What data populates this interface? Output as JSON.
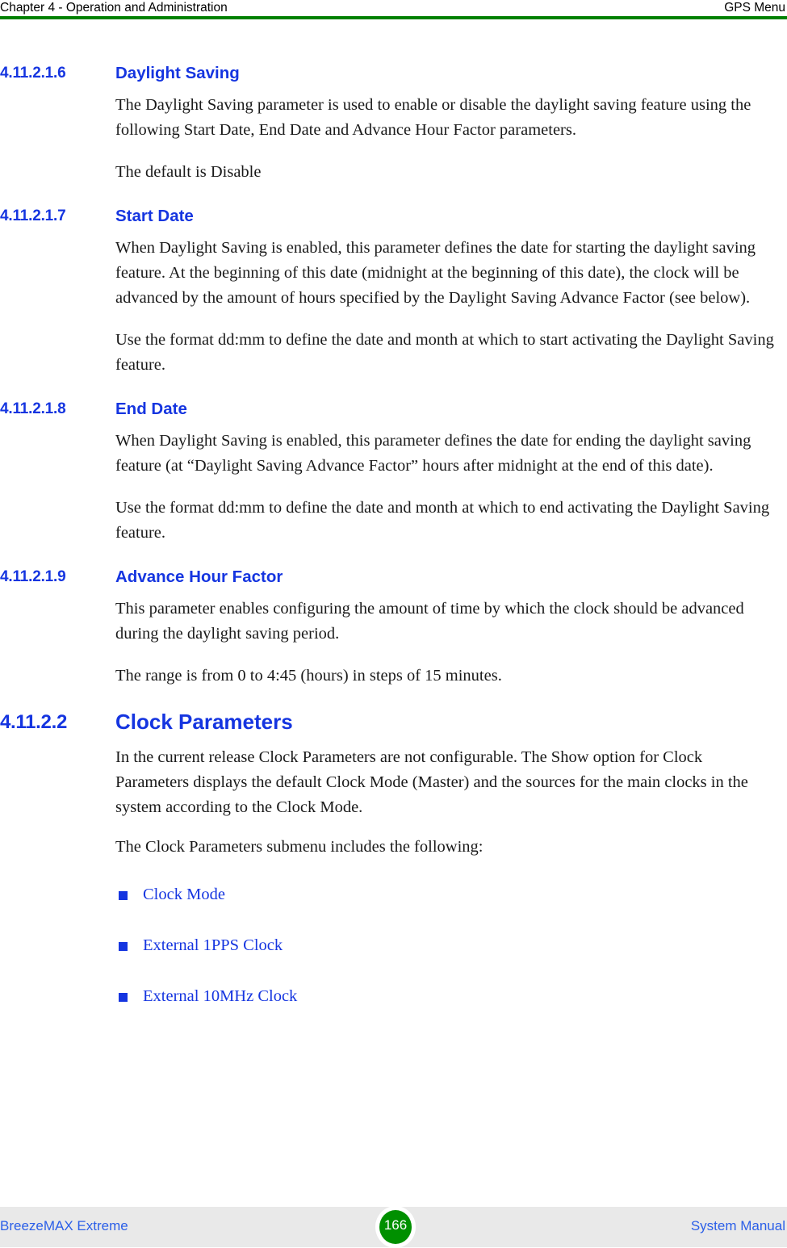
{
  "header": {
    "left": "Chapter 4 - Operation and Administration",
    "right": "GPS Menu",
    "rule_color": "#008000"
  },
  "colors": {
    "heading_blue": "#1535e0",
    "link_blue": "#1535e0",
    "footer_text_blue": "#2b5fe8",
    "rule_green": "#008000",
    "badge_green": "#009000",
    "footer_band": "#e9e9e9"
  },
  "sections": [
    {
      "number": "4.11.2.1.6",
      "title": "Daylight Saving",
      "paragraphs": [
        "The Daylight Saving parameter is used to enable or disable the daylight saving feature using the following Start Date, End Date and Advance Hour Factor parameters.",
        "The default is Disable"
      ]
    },
    {
      "number": "4.11.2.1.7",
      "title": "Start Date",
      "paragraphs": [
        "When Daylight Saving is enabled, this parameter defines the date for starting the daylight saving feature. At the beginning of this date (midnight at the beginning of this date), the clock will be advanced by the amount of hours specified by the Daylight Saving Advance Factor (see below).",
        "Use the format dd:mm to define the date and month at which to start activating the Daylight Saving feature."
      ]
    },
    {
      "number": "4.11.2.1.8",
      "title": "End Date",
      "paragraphs": [
        "When Daylight Saving is enabled, this parameter defines the date for ending the daylight saving feature (at “Daylight Saving Advance Factor” hours after midnight at the end of this date).",
        "Use the format dd:mm to define the date and month at which to end activating the Daylight Saving feature."
      ]
    },
    {
      "number": "4.11.2.1.9",
      "title": "Advance Hour Factor",
      "paragraphs": [
        "This parameter enables configuring the amount of time by which the clock should be advanced during the daylight saving period.",
        "The range is from 0 to 4:45 (hours) in steps of 15 minutes."
      ]
    },
    {
      "number": "4.11.2.2",
      "title": "Clock Parameters",
      "paragraphs": [
        "In the current release Clock Parameters are not configurable. The Show option for Clock Parameters displays the default Clock Mode (Master) and the sources for the main clocks in the system according to the Clock Mode.",
        "The Clock Parameters submenu includes the following:"
      ]
    }
  ],
  "xref_list": [
    {
      "label": "Clock Mode"
    },
    {
      "label": "External 1PPS Clock"
    },
    {
      "label": "External 10MHz Clock"
    }
  ],
  "footer": {
    "left": "BreezeMAX Extreme",
    "page_number": "166",
    "right": "System Manual"
  }
}
